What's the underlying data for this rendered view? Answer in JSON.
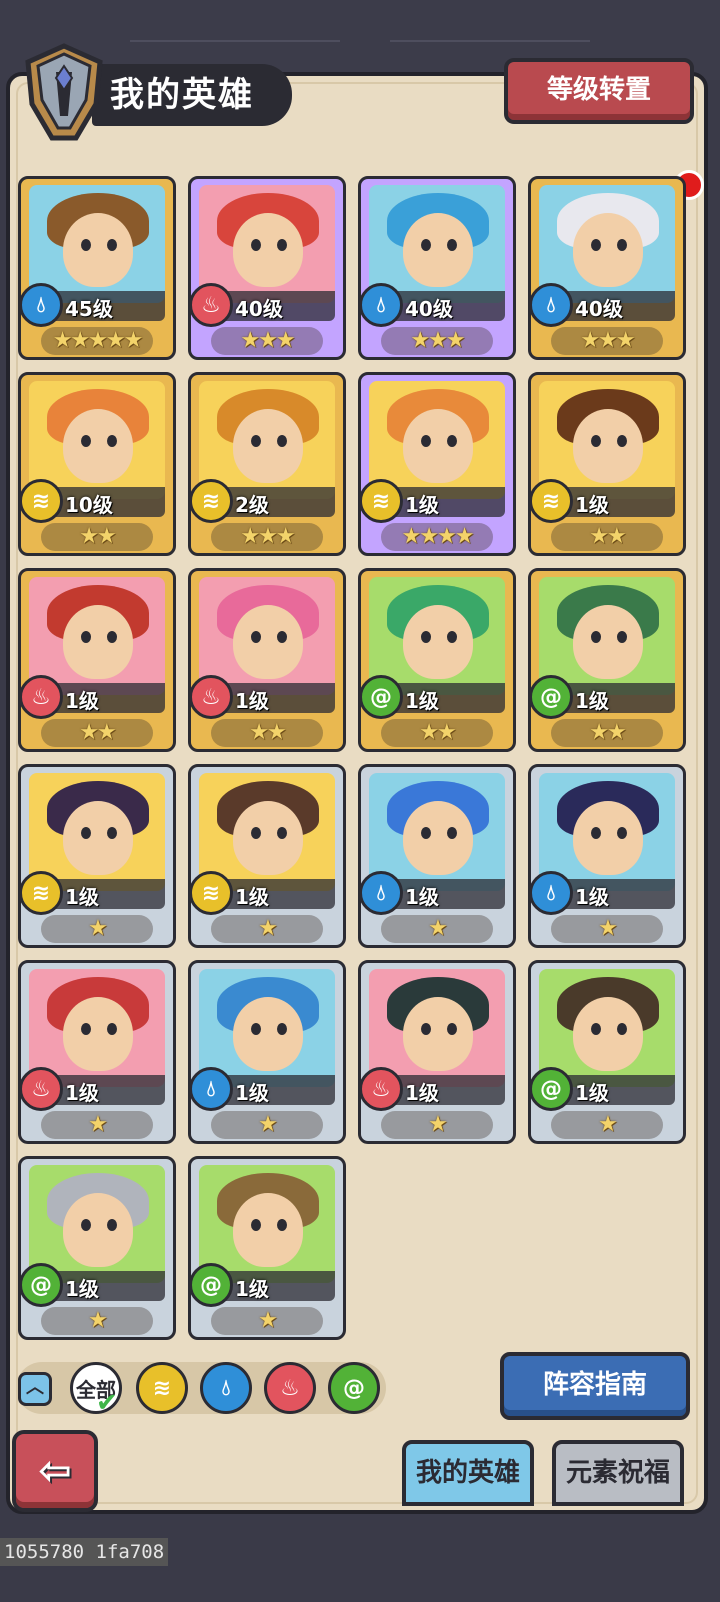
{
  "header": {
    "title": "我的英雄",
    "level_reset_button": "等级转置"
  },
  "heroes": [
    {
      "level": "45级",
      "stars": "★★★★★",
      "element": "water",
      "rarity": "gold",
      "bg": "water"
    },
    {
      "level": "40级",
      "stars": "★★★",
      "element": "fire",
      "rarity": "purple",
      "bg": "fire"
    },
    {
      "level": "40级",
      "stars": "★★★",
      "element": "water",
      "rarity": "purple",
      "bg": "water"
    },
    {
      "level": "40级",
      "stars": "★★★",
      "element": "water",
      "rarity": "gold",
      "bg": "water"
    },
    {
      "level": "10级",
      "stars": "★★",
      "element": "earth",
      "rarity": "gold",
      "bg": "earth"
    },
    {
      "level": "2级",
      "stars": "★★★",
      "element": "earth",
      "rarity": "gold",
      "bg": "earth"
    },
    {
      "level": "1级",
      "stars": "★★★★",
      "element": "earth",
      "rarity": "purple",
      "bg": "earth"
    },
    {
      "level": "1级",
      "stars": "★★",
      "element": "earth",
      "rarity": "gold",
      "bg": "earth"
    },
    {
      "level": "1级",
      "stars": "★★",
      "element": "fire",
      "rarity": "gold",
      "bg": "fire"
    },
    {
      "level": "1级",
      "stars": "★★",
      "element": "fire",
      "rarity": "gold",
      "bg": "fire"
    },
    {
      "level": "1级",
      "stars": "★★",
      "element": "nature",
      "rarity": "gold",
      "bg": "nature"
    },
    {
      "level": "1级",
      "stars": "★★",
      "element": "nature",
      "rarity": "gold",
      "bg": "nature"
    },
    {
      "level": "1级",
      "stars": "★",
      "element": "earth",
      "rarity": "silver",
      "bg": "earth"
    },
    {
      "level": "1级",
      "stars": "★",
      "element": "earth",
      "rarity": "silver",
      "bg": "earth"
    },
    {
      "level": "1级",
      "stars": "★",
      "element": "water",
      "rarity": "silver",
      "bg": "water"
    },
    {
      "level": "1级",
      "stars": "★",
      "element": "water",
      "rarity": "silver",
      "bg": "water"
    },
    {
      "level": "1级",
      "stars": "★",
      "element": "fire",
      "rarity": "silver",
      "bg": "fire"
    },
    {
      "level": "1级",
      "stars": "★",
      "element": "water",
      "rarity": "silver",
      "bg": "water"
    },
    {
      "level": "1级",
      "stars": "★",
      "element": "fire",
      "rarity": "silver",
      "bg": "fire"
    },
    {
      "level": "1级",
      "stars": "★",
      "element": "nature",
      "rarity": "silver",
      "bg": "nature"
    },
    {
      "level": "1级",
      "stars": "★",
      "element": "nature",
      "rarity": "silver",
      "bg": "nature"
    },
    {
      "level": "1级",
      "stars": "★",
      "element": "nature",
      "rarity": "silver",
      "bg": "nature"
    }
  ],
  "filters": {
    "all_label": "全部",
    "elements": [
      "earth",
      "water",
      "fire",
      "nature"
    ]
  },
  "lineup_guide_button": "阵容指南",
  "tabs": {
    "my_heroes": "我的英雄",
    "element_blessing": "元素祝福"
  },
  "debug_overlay": "1055780 1fa708",
  "colors": {
    "panel": "#e9dcc3",
    "water": "#2f8fd8",
    "fire": "#e2545e",
    "earth": "#e8c02a",
    "nature": "#52b237"
  }
}
